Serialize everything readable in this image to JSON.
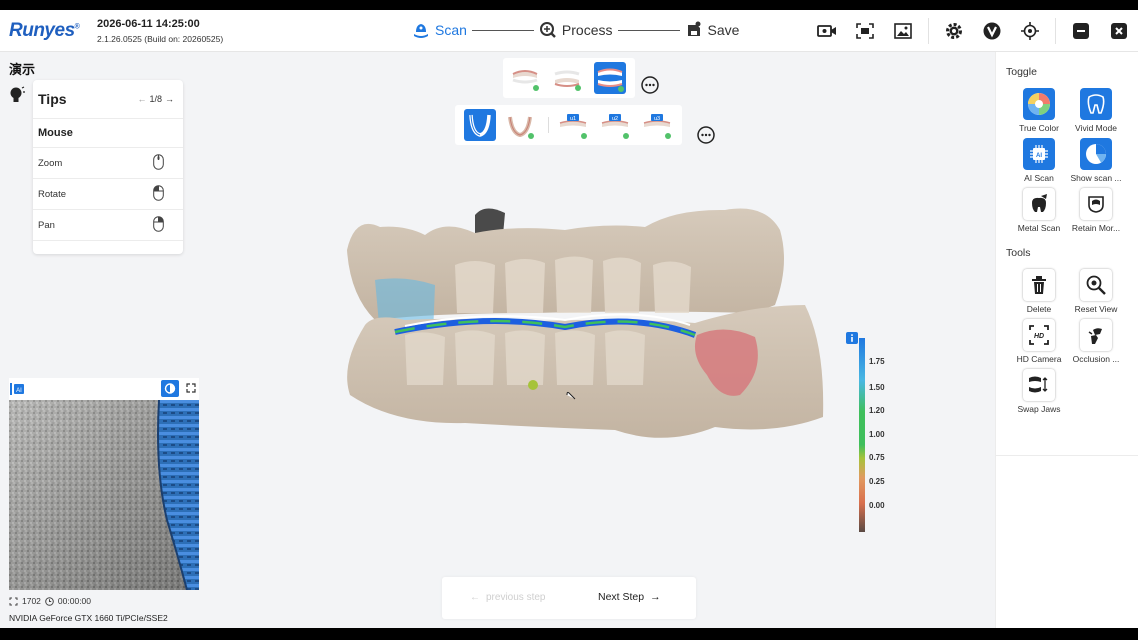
{
  "header": {
    "logo": "Runyes",
    "datetime": "2026-06-11 14:25:00",
    "version": "2.1.26.0525 (Build on: 20260525)",
    "steps": [
      {
        "label": "Scan",
        "active": true
      },
      {
        "label": "Process",
        "active": false
      },
      {
        "label": "Save",
        "active": false
      }
    ],
    "icons": [
      "video-record-icon",
      "screenshot-icon",
      "gallery-icon",
      "settings-icon",
      "v-brand-icon",
      "target-icon",
      "minimize-icon",
      "close-icon"
    ]
  },
  "left": {
    "demo_label": "演示",
    "tips": {
      "title": "Tips",
      "page": "1/8",
      "section": "Mouse",
      "rows": [
        {
          "label": "Zoom"
        },
        {
          "label": "Rotate"
        },
        {
          "label": "Pan"
        }
      ]
    },
    "camera": {
      "frame_count": "1702",
      "elapsed": "00:00:00"
    },
    "gpu": "NVIDIA GeForce GTX 1660 Ti/PCIe/SSE2"
  },
  "legend": {
    "values": [
      "1.75",
      "1.50",
      "1.20",
      "1.00",
      "0.75",
      "0.25",
      "0.00"
    ]
  },
  "toolbar_bottom": {
    "step_labels": [
      "u1",
      "u2",
      "u3"
    ]
  },
  "right": {
    "toggle_title": "Toggle",
    "toggle_items": [
      {
        "label": "True Color",
        "icon": "true-color-icon",
        "active": true
      },
      {
        "label": "Vivid Mode",
        "icon": "vivid-mode-icon",
        "active": true
      },
      {
        "label": "AI Scan",
        "icon": "ai-scan-icon",
        "active": true
      },
      {
        "label": "Show scan ...",
        "icon": "show-scan-icon",
        "active": true
      },
      {
        "label": "Metal Scan",
        "icon": "metal-scan-icon",
        "active": false
      },
      {
        "label": "Retain Mor...",
        "icon": "retain-icon",
        "active": false
      }
    ],
    "tools_title": "Tools",
    "tool_items": [
      {
        "label": "Delete",
        "icon": "trash-icon"
      },
      {
        "label": "Reset View",
        "icon": "reset-view-icon"
      },
      {
        "label": "HD Camera",
        "icon": "hd-camera-icon"
      },
      {
        "label": "Occlusion ...",
        "icon": "occlusion-icon"
      },
      {
        "label": "Swap Jaws",
        "icon": "swap-jaws-icon"
      }
    ]
  },
  "bottom_nav": {
    "prev_label": "previous step",
    "next_label": "Next Step"
  },
  "colors": {
    "accent": "#1f78e0",
    "logo": "#1f5fbf",
    "panel_bg": "#f3f4f6"
  }
}
